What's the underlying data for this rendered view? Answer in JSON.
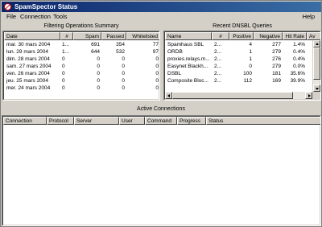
{
  "window": {
    "title": "SpamSpector Status"
  },
  "menu": {
    "file": "File",
    "connection": "Connection",
    "tools": "Tools",
    "help": "Help"
  },
  "filtering": {
    "title": "Filtering Operations Summary",
    "columns": [
      "Date",
      "#",
      "Spam",
      "Passed",
      "Whitelisted"
    ],
    "rows": [
      [
        "mar. 30 mars 2004",
        "1...",
        "691",
        "354",
        "77"
      ],
      [
        "lun. 29 mars 2004",
        "1...",
        "644",
        "532",
        "97"
      ],
      [
        "dim. 28 mars 2004",
        "0",
        "0",
        "0",
        "0"
      ],
      [
        "sam. 27 mars 2004",
        "0",
        "0",
        "0",
        "0"
      ],
      [
        "ven. 26 mars 2004",
        "0",
        "0",
        "0",
        "0"
      ],
      [
        "jeu. 25 mars 2004",
        "0",
        "0",
        "0",
        "0"
      ],
      [
        "mer. 24 mars 2004",
        "0",
        "0",
        "0",
        "0"
      ]
    ]
  },
  "dnsbl": {
    "title": "Recent DNSBL Queries",
    "columns": [
      "Name",
      "#",
      "Positive",
      "Negative",
      "Hit Rate",
      "Av"
    ],
    "rows": [
      [
        "Spamhaus SBL",
        "2...",
        "4",
        "277",
        "1.4%"
      ],
      [
        "ORDB",
        "2...",
        "1",
        "279",
        "0.4%"
      ],
      [
        "proxies.relays.m...",
        "2...",
        "1",
        "276",
        "0.4%"
      ],
      [
        "Easynet Blackh...",
        "2...",
        "0",
        "279",
        "0.0%"
      ],
      [
        "DSBL",
        "2...",
        "100",
        "181",
        "35.6%"
      ],
      [
        "Composite Bloc...",
        "2...",
        "112",
        "169",
        "39.9%"
      ]
    ]
  },
  "connections": {
    "title": "Active Connections",
    "columns": [
      "Connection",
      "Protocol",
      "Server",
      "User",
      "Command",
      "Progress",
      "Status"
    ]
  }
}
